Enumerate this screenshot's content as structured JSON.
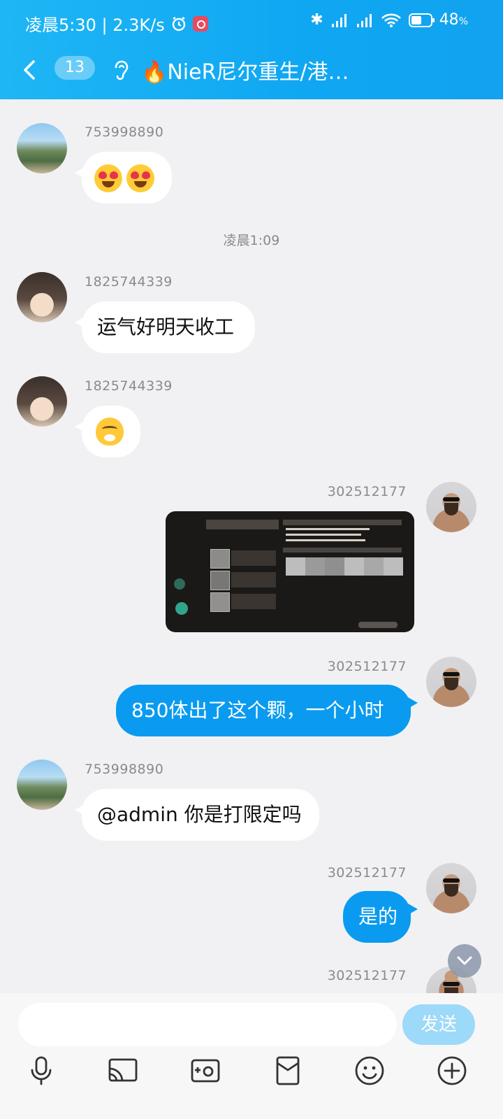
{
  "status_bar": {
    "time_info": "凌晨5:30 | 2.3K/s",
    "battery": "48",
    "battery_unit": "%"
  },
  "nav": {
    "unread_count": "13",
    "title": "🔥NieR尼尔重生/港…"
  },
  "messages": [
    {
      "sender": "753998890",
      "text": ""
    },
    {
      "timestamp": "凌晨1:09"
    },
    {
      "sender": "1825744339",
      "text": "运气好明天收工"
    },
    {
      "sender": "1825744339",
      "text": ""
    },
    {
      "sender": "302512177",
      "text": ""
    },
    {
      "sender": "302512177",
      "text": "850体出了这个颗，一个小时"
    },
    {
      "sender": "753998890",
      "text": "@admin 你是打限定吗"
    },
    {
      "sender": "302512177",
      "text": "是的"
    },
    {
      "sender": "302512177",
      "text": ""
    }
  ],
  "input": {
    "placeholder": "",
    "send_label": "发送"
  },
  "colors": {
    "header": "#12a6f2",
    "bubble_self": "#0a9bf0",
    "send_disabled": "#9dd9f8"
  }
}
